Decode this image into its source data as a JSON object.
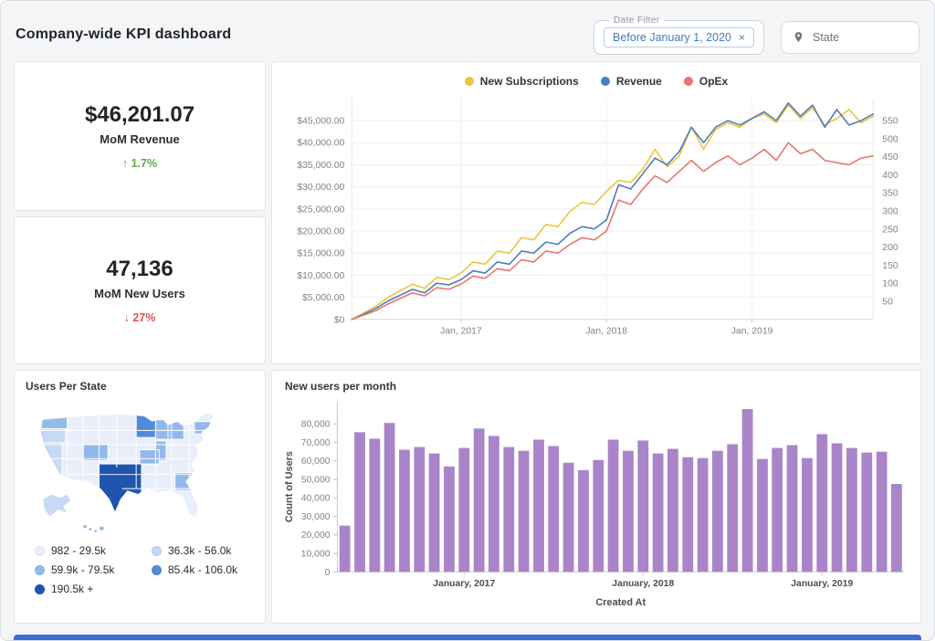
{
  "page": {
    "title": "Company-wide KPI dashboard"
  },
  "filters": {
    "date": {
      "label": "Date Filter",
      "chip": "Before January 1, 2020",
      "remove": "×"
    },
    "state": {
      "label": "State"
    }
  },
  "colors": {
    "positive": "#61a64c",
    "negative": "#e05252",
    "accent_bar": "#3b6cd6"
  },
  "kpis": [
    {
      "value": "$46,201.07",
      "label": "MoM Revenue",
      "arrow": "↑",
      "delta": "1.7%",
      "direction": "up"
    },
    {
      "value": "47,136",
      "label": "MoM New Users",
      "arrow": "↓",
      "delta": "27%",
      "direction": "down"
    }
  ],
  "map": {
    "title": "Users Per State",
    "legend": [
      {
        "label": "982 - 29.5k",
        "color": "#e9eefb"
      },
      {
        "label": "36.3k - 56.0k",
        "color": "#c6d9f5"
      },
      {
        "label": "59.9k - 79.5k",
        "color": "#93b9ec"
      },
      {
        "label": "85.4k - 106.0k",
        "color": "#5289d9"
      },
      {
        "label": "190.5k +",
        "color": "#1f55ae"
      }
    ]
  },
  "chart_data": [
    {
      "type": "line",
      "name": "company-kpi-trend",
      "x_start": "Apr 2016",
      "x_ticks": [
        {
          "label": "Jan, 2017",
          "index": 9
        },
        {
          "label": "Jan, 2018",
          "index": 21
        },
        {
          "label": "Jan, 2019",
          "index": 33
        }
      ],
      "y_left": {
        "min": 0,
        "max": 50000,
        "grid_step": 5000,
        "tick_labels": [
          "$0",
          "$5,000.00",
          "$10,000.00",
          "$15,000.00",
          "$20,000.00",
          "$25,000.00",
          "$30,000.00",
          "$35,000.00",
          "$40,000.00",
          "$45,000.00"
        ]
      },
      "y_right": {
        "tick_labels": [
          "50",
          "100",
          "150",
          "200",
          "250",
          "300",
          "350",
          "400",
          "450",
          "500",
          "550"
        ],
        "max_label_value": 550
      },
      "series": [
        {
          "name": "New Subscriptions",
          "color": "#f0c33c",
          "values": [
            0,
            1500,
            3000,
            5000,
            6500,
            8000,
            7000,
            9500,
            9000,
            10500,
            13000,
            12500,
            15500,
            15000,
            18500,
            18000,
            21500,
            21000,
            24500,
            26500,
            26000,
            29000,
            31500,
            31000,
            34000,
            38500,
            34500,
            37000,
            43500,
            38500,
            43000,
            44500,
            43500,
            45500,
            46500,
            44500,
            48500,
            45500,
            48000,
            44000,
            45500,
            47500,
            44500,
            46000
          ]
        },
        {
          "name": "Revenue",
          "color": "#4a7ebb",
          "values": [
            0,
            1200,
            2500,
            4200,
            5500,
            6800,
            6000,
            8200,
            7800,
            9000,
            11000,
            10500,
            13000,
            12500,
            15500,
            15000,
            17500,
            17000,
            19500,
            21000,
            20500,
            22500,
            30500,
            29500,
            33000,
            36500,
            35000,
            38000,
            43500,
            40000,
            43500,
            45000,
            44000,
            45500,
            47000,
            45000,
            49000,
            46000,
            48500,
            43500,
            47500,
            44000,
            45000,
            46500
          ]
        },
        {
          "name": "OpEx",
          "color": "#e8756d",
          "values": [
            0,
            1000,
            2000,
            3500,
            4800,
            6000,
            5300,
            7200,
            6800,
            8000,
            9800,
            9300,
            11500,
            11000,
            13500,
            13000,
            15500,
            15000,
            17000,
            18500,
            18000,
            20000,
            27000,
            26000,
            29500,
            32500,
            31000,
            33500,
            36000,
            33500,
            35500,
            37000,
            35000,
            36500,
            38500,
            36000,
            40000,
            37500,
            38500,
            36000,
            35500,
            35000,
            36500,
            37000
          ]
        }
      ]
    },
    {
      "type": "bar",
      "title": "New users per month",
      "xlabel": "Created At",
      "ylabel": "Count of Users",
      "bar_color": "#aa84c8",
      "ylim": [
        0,
        92000
      ],
      "y_ticks": [
        0,
        10000,
        20000,
        30000,
        40000,
        50000,
        60000,
        70000,
        80000
      ],
      "y_tick_labels": [
        "0",
        "10,000",
        "20,000",
        "30,000",
        "40,000",
        "50,000",
        "60,000",
        "70,000",
        "80,000"
      ],
      "x_ticks": [
        {
          "label": "January, 2017",
          "index": 8
        },
        {
          "label": "January, 2018",
          "index": 20
        },
        {
          "label": "January, 2019",
          "index": 32
        }
      ],
      "values": [
        25000,
        75500,
        72000,
        80500,
        66000,
        67500,
        64000,
        57000,
        67000,
        77500,
        73500,
        67500,
        65500,
        71500,
        68000,
        59000,
        55000,
        60500,
        71500,
        65500,
        71000,
        64000,
        66500,
        62000,
        61500,
        65500,
        69000,
        88000,
        61000,
        67000,
        68500,
        61500,
        74500,
        69500,
        67000,
        64500,
        65000,
        47500
      ]
    }
  ]
}
